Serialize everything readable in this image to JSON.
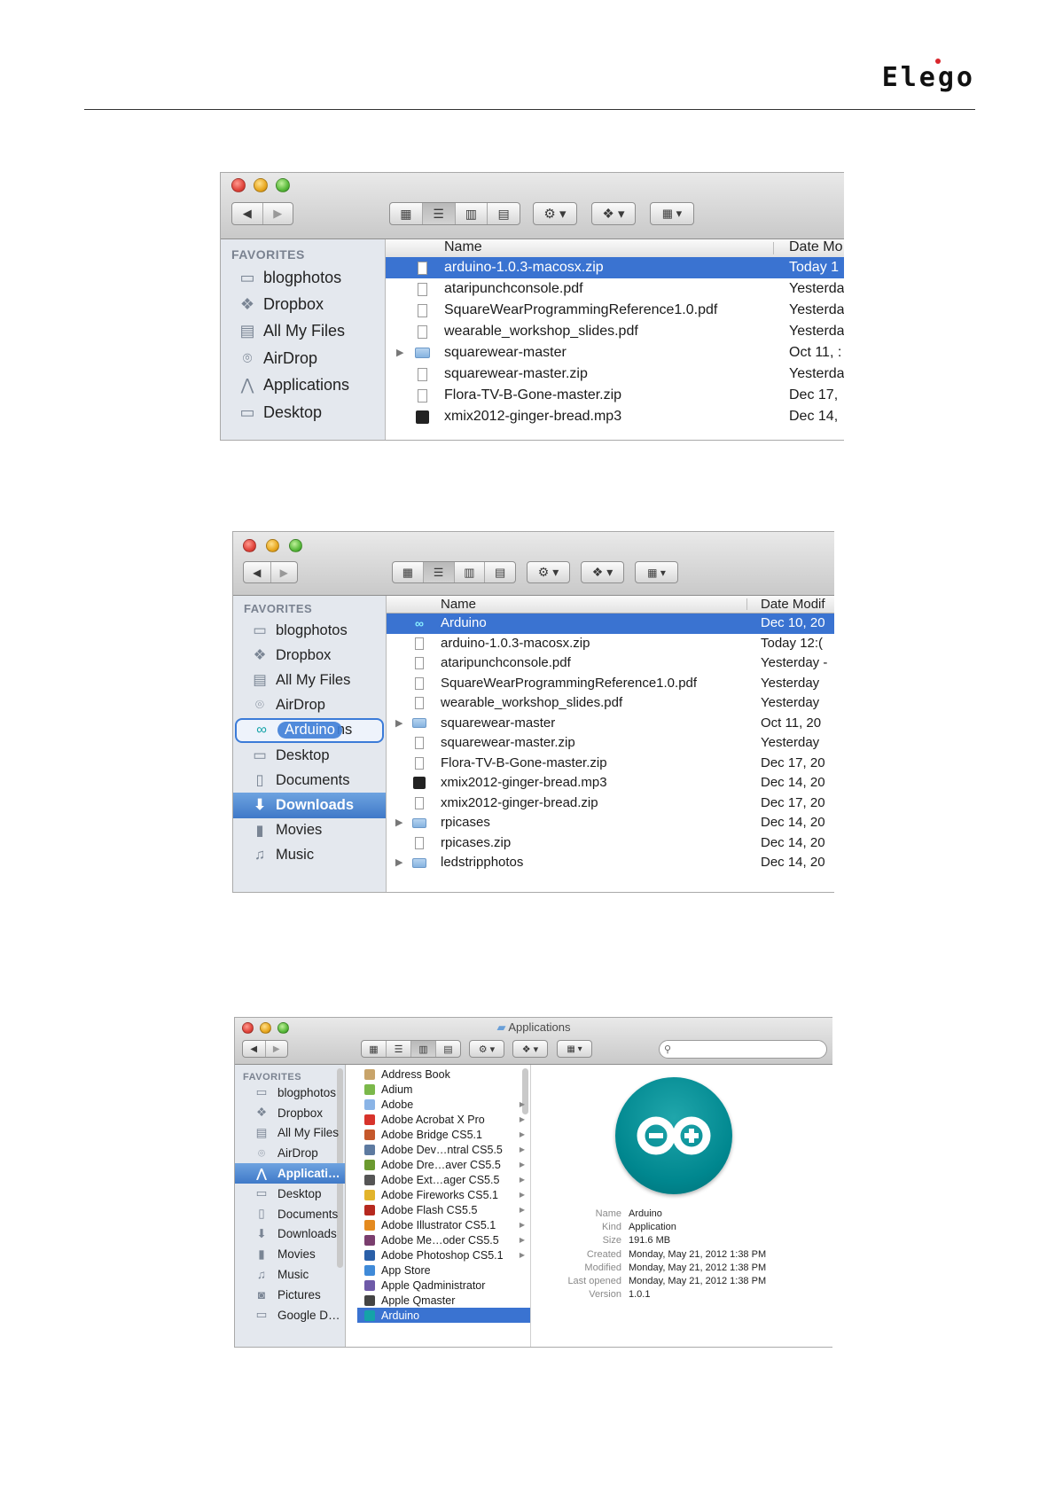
{
  "header": {
    "logo": "Elego"
  },
  "shot1": {
    "sidebar": {
      "heading": "FAVORITES",
      "items": [
        {
          "label": "blogphotos",
          "icon": "folder-icon"
        },
        {
          "label": "Dropbox",
          "icon": "dropbox-icon"
        },
        {
          "label": "All My Files",
          "icon": "all-files-icon"
        },
        {
          "label": "AirDrop",
          "icon": "airdrop-icon"
        },
        {
          "label": "Applications",
          "icon": "applications-icon"
        },
        {
          "label": "Desktop",
          "icon": "desktop-icon"
        }
      ]
    },
    "columns": {
      "name": "Name",
      "date": "Date Mo"
    },
    "rows": [
      {
        "name": "arduino-1.0.3-macosx.zip",
        "date": "Today 1",
        "kind": "zip",
        "selected": true
      },
      {
        "name": "ataripunchconsole.pdf",
        "date": "Yesterda",
        "kind": "pdf"
      },
      {
        "name": "SquareWearProgrammingReference1.0.pdf",
        "date": "Yesterda",
        "kind": "pdf"
      },
      {
        "name": "wearable_workshop_slides.pdf",
        "date": "Yesterda",
        "kind": "pdf"
      },
      {
        "name": "squarewear-master",
        "date": "Oct 11, :",
        "kind": "folder"
      },
      {
        "name": "squarewear-master.zip",
        "date": "Yesterda",
        "kind": "zip"
      },
      {
        "name": "Flora-TV-B-Gone-master.zip",
        "date": "Dec 17,",
        "kind": "zip"
      },
      {
        "name": "xmix2012-ginger-bread.mp3",
        "date": "Dec 14,",
        "kind": "music"
      }
    ]
  },
  "shot2": {
    "sidebar": {
      "heading": "FAVORITES",
      "items": [
        {
          "label": "blogphotos",
          "icon": "folder-icon"
        },
        {
          "label": "Dropbox",
          "icon": "dropbox-icon"
        },
        {
          "label": "All My Files",
          "icon": "all-files-icon"
        },
        {
          "label": "AirDrop",
          "icon": "airdrop-icon"
        },
        {
          "label": "Arduino",
          "tail": "ns",
          "icon": "arduino-icon",
          "drop": true
        },
        {
          "label": "Desktop",
          "icon": "desktop-icon"
        },
        {
          "label": "Documents",
          "icon": "documents-icon"
        },
        {
          "label": "Downloads",
          "icon": "downloads-icon",
          "selected": true
        },
        {
          "label": "Movies",
          "icon": "movies-icon"
        },
        {
          "label": "Music",
          "icon": "music-icon"
        }
      ]
    },
    "columns": {
      "name": "Name",
      "date": "Date Modif"
    },
    "rows": [
      {
        "name": "Arduino",
        "date": "Dec 10, 20",
        "kind": "arduino",
        "selected": true
      },
      {
        "name": "arduino-1.0.3-macosx.zip",
        "date": "Today 12:(",
        "kind": "zip"
      },
      {
        "name": "ataripunchconsole.pdf",
        "date": "Yesterday -",
        "kind": "pdf"
      },
      {
        "name": "SquareWearProgrammingReference1.0.pdf",
        "date": "Yesterday",
        "kind": "pdf"
      },
      {
        "name": "wearable_workshop_slides.pdf",
        "date": "Yesterday",
        "kind": "pdf"
      },
      {
        "name": "squarewear-master",
        "date": "Oct 11, 20",
        "kind": "folder"
      },
      {
        "name": "squarewear-master.zip",
        "date": "Yesterday",
        "kind": "zip"
      },
      {
        "name": "Flora-TV-B-Gone-master.zip",
        "date": "Dec 17, 20",
        "kind": "zip"
      },
      {
        "name": "xmix2012-ginger-bread.mp3",
        "date": "Dec 14, 20",
        "kind": "music"
      },
      {
        "name": "xmix2012-ginger-bread.zip",
        "date": "Dec 17, 20",
        "kind": "zip"
      },
      {
        "name": "rpicases",
        "date": "Dec 14, 20",
        "kind": "folder"
      },
      {
        "name": "rpicases.zip",
        "date": "Dec 14, 20",
        "kind": "zip"
      },
      {
        "name": "ledstripphotos",
        "date": "Dec 14, 20",
        "kind": "folder"
      }
    ]
  },
  "shot3": {
    "title": "Applications",
    "sidebar": {
      "heading": "FAVORITES",
      "items": [
        {
          "label": "blogphotos",
          "icon": "folder-icon"
        },
        {
          "label": "Dropbox",
          "icon": "dropbox-icon"
        },
        {
          "label": "All My Files",
          "icon": "all-files-icon"
        },
        {
          "label": "AirDrop",
          "icon": "airdrop-icon"
        },
        {
          "label": "Applicati…",
          "icon": "applications-icon",
          "selected": true
        },
        {
          "label": "Desktop",
          "icon": "desktop-icon"
        },
        {
          "label": "Documents",
          "icon": "documents-icon"
        },
        {
          "label": "Downloads",
          "icon": "downloads-icon"
        },
        {
          "label": "Movies",
          "icon": "movies-icon"
        },
        {
          "label": "Music",
          "icon": "music-icon"
        },
        {
          "label": "Pictures",
          "icon": "pictures-icon"
        },
        {
          "label": "Google D…",
          "icon": "folder-icon"
        }
      ]
    },
    "apps": [
      {
        "name": "Address Book",
        "color": "#c8a46a",
        "arrow": false
      },
      {
        "name": "Adium",
        "color": "#7bb84a",
        "arrow": false
      },
      {
        "name": "Adobe",
        "color": "#8ab4e6",
        "arrow": true
      },
      {
        "name": "Adobe Acrobat X Pro",
        "color": "#d7332b",
        "arrow": true
      },
      {
        "name": "Adobe Bridge CS5.1",
        "color": "#c5582b",
        "arrow": true
      },
      {
        "name": "Adobe Dev…ntral CS5.5",
        "color": "#5d7aa0",
        "arrow": true
      },
      {
        "name": "Adobe Dre…aver CS5.5",
        "color": "#6b9a2f",
        "arrow": true
      },
      {
        "name": "Adobe Ext…ager CS5.5",
        "color": "#555555",
        "arrow": true
      },
      {
        "name": "Adobe Fireworks CS5.1",
        "color": "#e2b42b",
        "arrow": true
      },
      {
        "name": "Adobe Flash CS5.5",
        "color": "#b6291f",
        "arrow": true
      },
      {
        "name": "Adobe Illustrator CS5.1",
        "color": "#e48a1f",
        "arrow": true
      },
      {
        "name": "Adobe Me…oder CS5.5",
        "color": "#7a3e6e",
        "arrow": true
      },
      {
        "name": "Adobe Photoshop CS5.1",
        "color": "#2a5fa8",
        "arrow": true
      },
      {
        "name": "App Store",
        "color": "#3f8ad8",
        "arrow": false
      },
      {
        "name": "Apple Qadministrator",
        "color": "#6e5aa8",
        "arrow": false
      },
      {
        "name": "Apple Qmaster",
        "color": "#444444",
        "arrow": false
      },
      {
        "name": "Arduino",
        "color": "#14a3a8",
        "arrow": false,
        "selected": true
      }
    ],
    "info": [
      {
        "key": "Name",
        "value": "Arduino"
      },
      {
        "key": "Kind",
        "value": "Application"
      },
      {
        "key": "Size",
        "value": "191.6 MB"
      },
      {
        "key": "Created",
        "value": "Monday, May 21, 2012 1:38 PM"
      },
      {
        "key": "Modified",
        "value": "Monday, May 21, 2012 1:38 PM"
      },
      {
        "key": "Last opened",
        "value": "Monday, May 21, 2012 1:38 PM"
      },
      {
        "key": "Version",
        "value": "1.0.1"
      }
    ]
  },
  "accent": "#3a73d1",
  "arduino_color": "#00878f"
}
